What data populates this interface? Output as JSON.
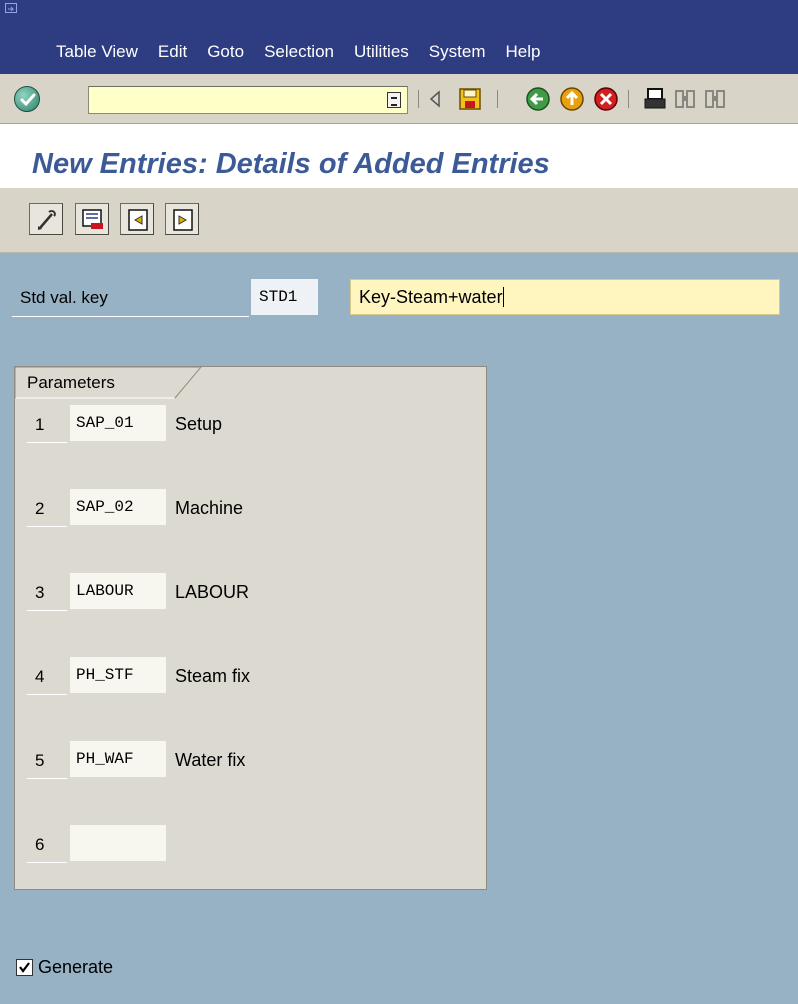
{
  "menu": {
    "items": [
      {
        "label": "Table View"
      },
      {
        "label": "Edit"
      },
      {
        "label": "Goto"
      },
      {
        "label": "Selection"
      },
      {
        "label": "Utilities"
      },
      {
        "label": "System"
      },
      {
        "label": "Help"
      }
    ]
  },
  "toolbar": {
    "command_field_value": "",
    "icons": [
      "enter-icon",
      "command-dropdown-icon",
      "back-triangle-icon",
      "save-icon",
      "back-icon",
      "exit-icon",
      "cancel-icon",
      "print-icon",
      "find-icon",
      "find-next-icon"
    ]
  },
  "title": "New Entries: Details of Added Entries",
  "app_toolbar": {
    "icons": [
      "change-display-icon",
      "delete-icon",
      "previous-entry-icon",
      "next-entry-icon"
    ]
  },
  "std_val": {
    "label": "Std val. key",
    "key": "STD1",
    "text": "Key-Steam+water"
  },
  "parameters": {
    "title": "Parameters",
    "rows": [
      {
        "num": "1",
        "code": "SAP_01",
        "desc": "Setup"
      },
      {
        "num": "2",
        "code": "SAP_02",
        "desc": "Machine"
      },
      {
        "num": "3",
        "code": "LABOUR",
        "desc": "LABOUR"
      },
      {
        "num": "4",
        "code": "PH_STF",
        "desc": "Steam fix"
      },
      {
        "num": "5",
        "code": "PH_WAF",
        "desc": "Water fix"
      },
      {
        "num": "6",
        "code": "",
        "desc": ""
      }
    ]
  },
  "generate": {
    "label": "Generate",
    "checked": true
  },
  "colors": {
    "menubar": "#2e3c82",
    "background": "#97b2c4",
    "title": "#3c5a96",
    "input_yellow": "#fff5bf"
  }
}
